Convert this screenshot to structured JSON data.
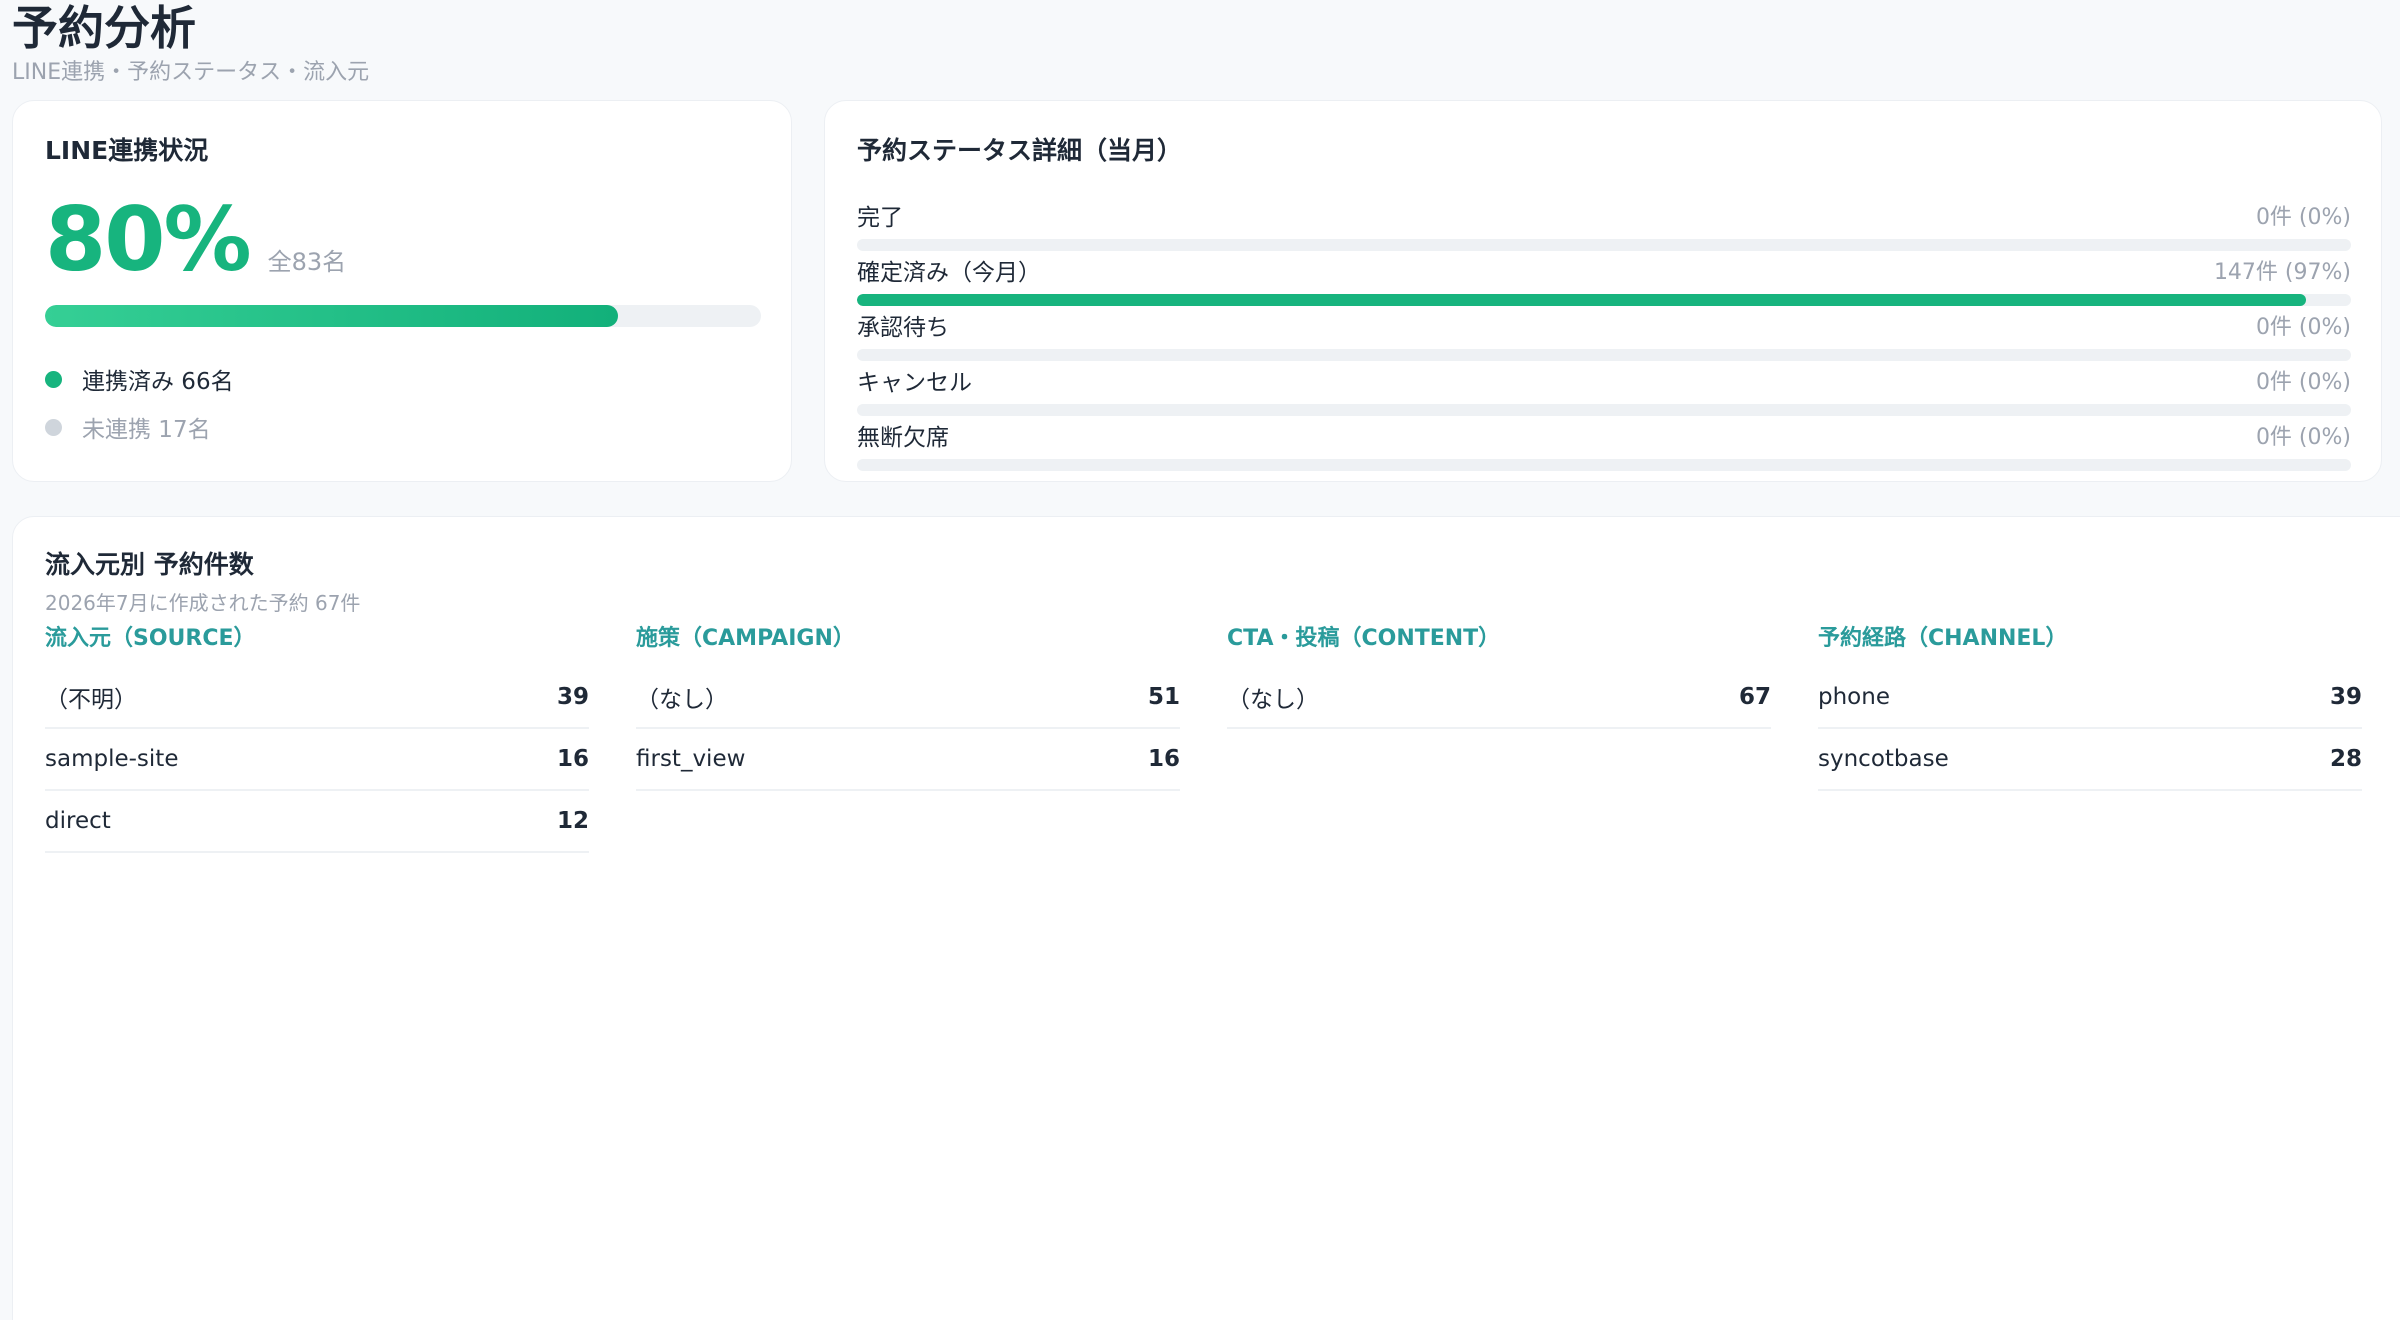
{
  "header": {
    "title": "予約分析",
    "subtitle": "LINE連携・予約ステータス・流入元"
  },
  "line_card": {
    "title": "LINE連携状況",
    "percent_label": "80%",
    "linked_ratio": 0.8,
    "total_label": "全83名",
    "legend": [
      {
        "label": "連携済み 66名"
      },
      {
        "label": "未連携 17名"
      }
    ]
  },
  "status_card": {
    "title": "予約ステータス詳細（当月）",
    "items": [
      {
        "label": "完了",
        "count": "0件 (0%)",
        "ratio": 0
      },
      {
        "label": "確定済み（今月）",
        "count": "147件 (97%)",
        "ratio": 0.97
      },
      {
        "label": "承認待ち",
        "count": "0件 (0%)",
        "ratio": 0
      },
      {
        "label": "キャンセル",
        "count": "0件 (0%)",
        "ratio": 0
      },
      {
        "label": "無断欠席",
        "count": "0件 (0%)",
        "ratio": 0
      }
    ]
  },
  "source_card": {
    "title": "流入元別 予約件数",
    "subtitle": "2026年7月に作成された予約 67件",
    "columns": [
      {
        "title": "流入元（SOURCE）",
        "rows": [
          {
            "name": "（不明）",
            "value": "39"
          },
          {
            "name": "sample-site",
            "value": "16"
          },
          {
            "name": "direct",
            "value": "12"
          }
        ]
      },
      {
        "title": "施策（CAMPAIGN）",
        "rows": [
          {
            "name": "（なし）",
            "value": "51"
          },
          {
            "name": "first_view",
            "value": "16"
          }
        ]
      },
      {
        "title": "CTA・投稿（CONTENT）",
        "rows": [
          {
            "name": "（なし）",
            "value": "67"
          }
        ]
      },
      {
        "title": "予約経路（CHANNEL）",
        "rows": [
          {
            "name": "phone",
            "value": "39"
          },
          {
            "name": "syncotbase",
            "value": "28"
          }
        ]
      }
    ]
  }
}
